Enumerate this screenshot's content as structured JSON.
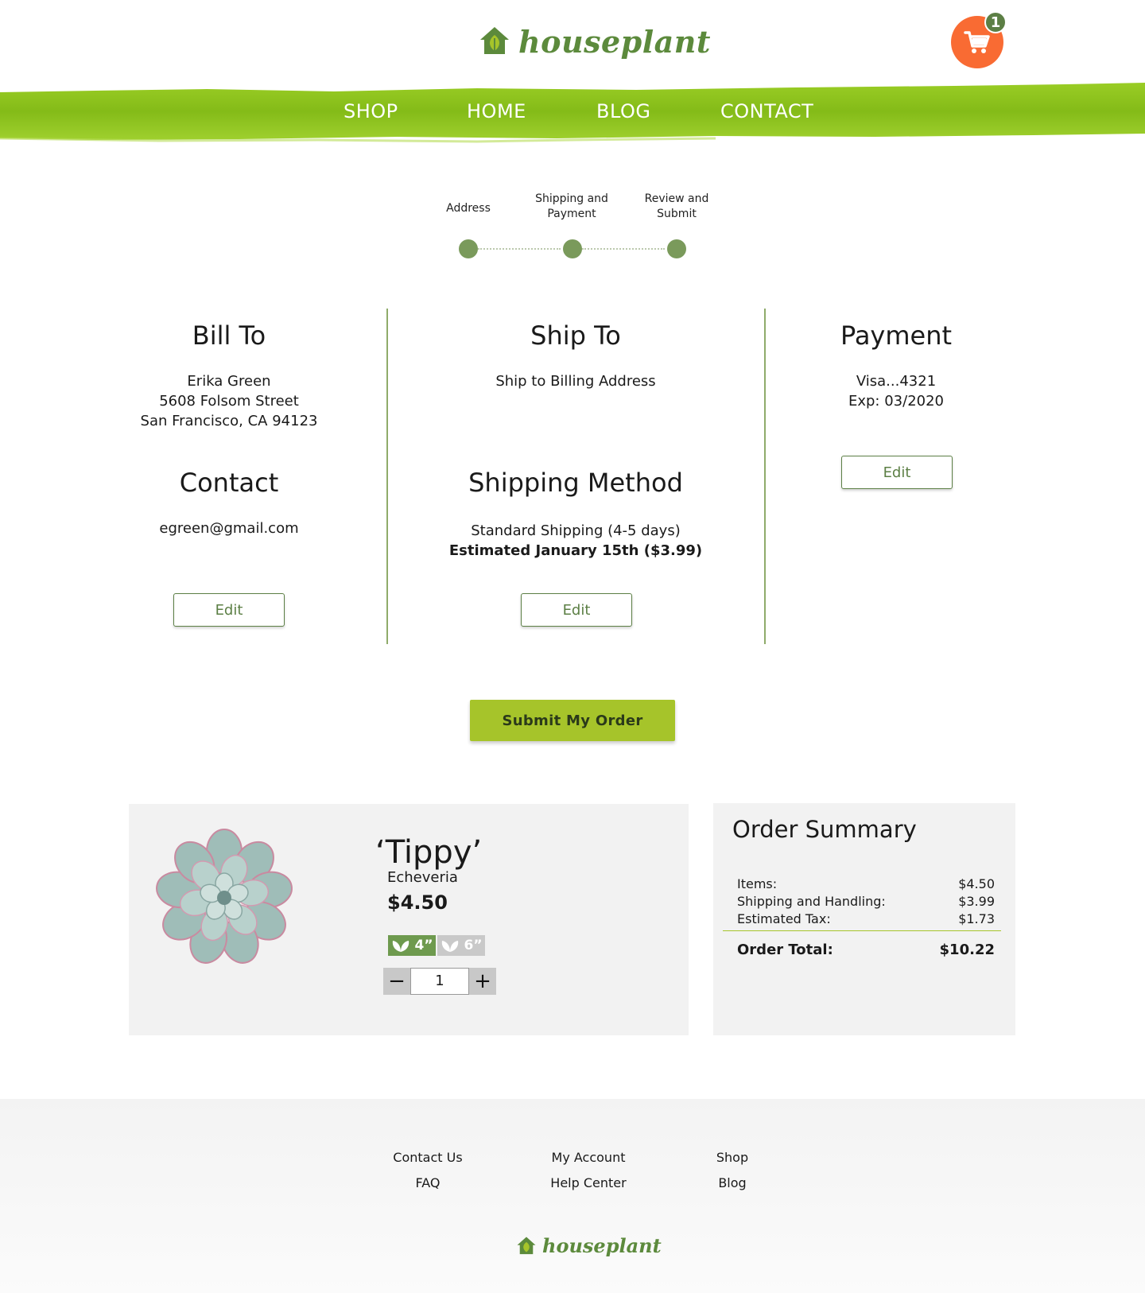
{
  "header": {
    "logo_text": "houseplant",
    "cart_count": "1",
    "nav": [
      "SHOP",
      "HOME",
      "BLOG",
      "CONTACT"
    ]
  },
  "steps": [
    "Address",
    "Shipping and Payment",
    "Review and Submit"
  ],
  "bill_to": {
    "title": "Bill To",
    "name": "Erika Green",
    "street": "5608 Folsom Street",
    "city": "San Francisco, CA 94123"
  },
  "contact": {
    "title": "Contact",
    "email": "egreen@gmail.com"
  },
  "ship_to": {
    "title": "Ship To",
    "text": "Ship to Billing Address"
  },
  "shipping_method": {
    "title": "Shipping Method",
    "line1": "Standard Shipping (4-5 days)",
    "line2": "Estimated January 15th ($3.99)"
  },
  "payment": {
    "title": "Payment",
    "card": "Visa...4321",
    "exp": "Exp: 03/2020"
  },
  "edit_label": "Edit",
  "submit_label": "Submit My Order",
  "item": {
    "name": "‘Tippy’",
    "type": "Echeveria",
    "price": "$4.50",
    "sizes": [
      "4”",
      "6”"
    ],
    "selected_size": "4”",
    "quantity": "1",
    "minus": "−",
    "plus": "+"
  },
  "summary": {
    "title": "Order Summary",
    "rows": [
      {
        "label": "Items:",
        "value": "$4.50"
      },
      {
        "label": "Shipping and Handling:",
        "value": "$3.99"
      },
      {
        "label": "Estimated Tax:",
        "value": "$1.73"
      }
    ],
    "total_label": "Order Total:",
    "total_value": "$10.22"
  },
  "footer": {
    "links": [
      "Contact Us",
      "FAQ",
      "My Account",
      "Help Center",
      "Shop",
      "Blog"
    ],
    "logo_text": "houseplant"
  },
  "colors": {
    "brand_green": "#5c8a3c",
    "nav_green": "#8cc21c",
    "accent_lime": "#a6c42a",
    "cart_orange": "#f96b33",
    "step_green": "#7a9a5b"
  }
}
